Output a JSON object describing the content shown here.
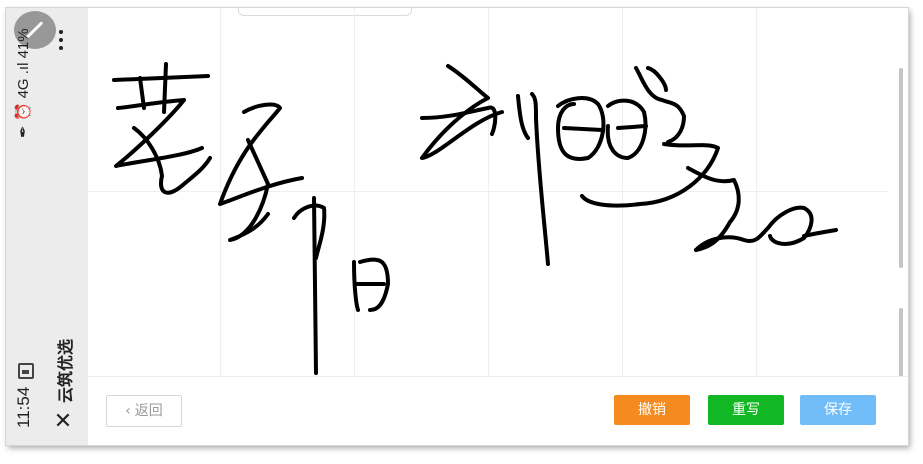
{
  "status_bar": {
    "time": "11:54",
    "indicators": "✒ ⏰ 4G .ıl 41%"
  },
  "app": {
    "title": "云筑优选",
    "close_icon": "close-icon"
  },
  "toolbar": {
    "back_label": "返回",
    "undo_label": "撤销",
    "redo_label": "重写",
    "save_label": "保存"
  },
  "colors": {
    "undo": "#f58b1e",
    "redo": "#12b824",
    "save": "#71bdf9",
    "ink": "#000000"
  }
}
